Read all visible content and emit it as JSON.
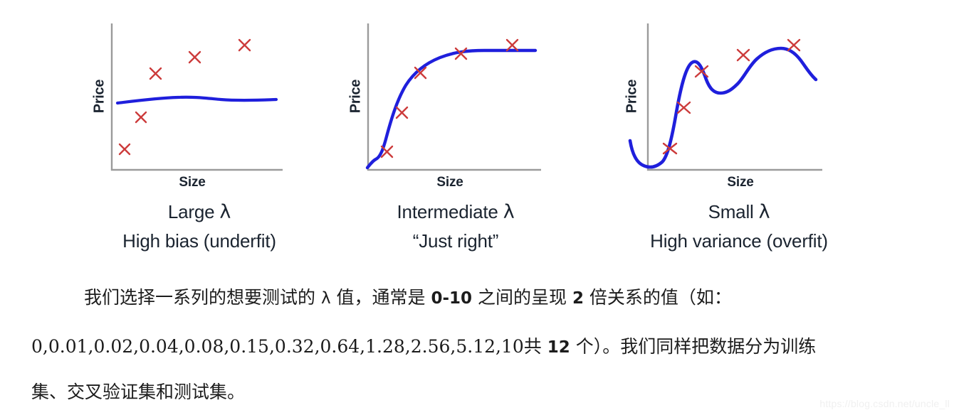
{
  "panels": [
    {
      "id": "large-lambda",
      "y_axis_label": "Price",
      "x_axis_label": "Size",
      "caption_main_prefix": "Large ",
      "caption_lambda": "λ",
      "caption_sub": "High bias (underfit)"
    },
    {
      "id": "intermediate-lambda",
      "y_axis_label": "Price",
      "x_axis_label": "Size",
      "caption_main_prefix": "Intermediate ",
      "caption_lambda": "λ",
      "caption_sub": "“Just right”"
    },
    {
      "id": "small-lambda",
      "y_axis_label": "Price",
      "x_axis_label": "Size",
      "caption_main_prefix": "Small ",
      "caption_lambda": "λ",
      "caption_sub": "High variance (overfit)"
    }
  ],
  "body_text": {
    "line1_a": "我们选择一系列的想要测试的 ",
    "line1_lambda": "λ",
    "line1_b": " 值，通常是 ",
    "line1_num1": "0-10",
    "line1_c": " 之间的呈现 ",
    "line1_num2": "2",
    "line1_d": " 倍关系的值（如：",
    "line2_nums": "0,0.01,0.02,0.04,0.08,0.15,0.32,0.64,1.28,2.56,5.12,10",
    "line2_a": "共 ",
    "line2_num": "12",
    "line2_b": " 个）。我们同样把数据分为训练",
    "line3": "集、交叉验证集和测试集。"
  },
  "watermark": "https://blog.csdn.net/uncle_ll",
  "colors": {
    "curve": "#1f1fdc",
    "marker": "#cc3b3b",
    "axis": "#9b9b9b",
    "text": "#1b2430",
    "body_text": "#1c1c1c",
    "watermark": "#f0f0f0",
    "background": "#ffffff"
  },
  "chart_data": [
    {
      "type": "scatter",
      "title": "Large λ — High bias (underfit)",
      "xlabel": "Size",
      "ylabel": "Price",
      "xlim": [
        0,
        100
      ],
      "ylim": [
        0,
        100
      ],
      "grid": false,
      "legend": null,
      "scatter_points": [
        {
          "x": 11,
          "y": 14
        },
        {
          "x": 20,
          "y": 35
        },
        {
          "x": 29,
          "y": 65
        },
        {
          "x": 50,
          "y": 76
        },
        {
          "x": 73,
          "y": 84
        }
      ],
      "curve": {
        "name": "fitted model",
        "points": [
          {
            "x": 5,
            "y": 50
          },
          {
            "x": 20,
            "y": 51
          },
          {
            "x": 35,
            "y": 52
          },
          {
            "x": 48,
            "y": 53
          },
          {
            "x": 60,
            "y": 52
          },
          {
            "x": 75,
            "y": 51
          },
          {
            "x": 92,
            "y": 51
          }
        ]
      }
    },
    {
      "type": "scatter",
      "title": "Intermediate λ — “Just right”",
      "xlabel": "Size",
      "ylabel": "Price",
      "xlim": [
        0,
        100
      ],
      "ylim": [
        0,
        100
      ],
      "grid": false,
      "legend": null,
      "scatter_points": [
        {
          "x": 13,
          "y": 12
        },
        {
          "x": 21,
          "y": 37
        },
        {
          "x": 37,
          "y": 63
        },
        {
          "x": 57,
          "y": 76
        },
        {
          "x": 84,
          "y": 82
        }
      ],
      "curve": {
        "name": "fitted model",
        "points": [
          {
            "x": 2,
            "y": 2
          },
          {
            "x": 8,
            "y": 6
          },
          {
            "x": 14,
            "y": 22
          },
          {
            "x": 22,
            "y": 44
          },
          {
            "x": 30,
            "y": 58
          },
          {
            "x": 42,
            "y": 68
          },
          {
            "x": 55,
            "y": 74
          },
          {
            "x": 66,
            "y": 76
          },
          {
            "x": 80,
            "y": 76
          },
          {
            "x": 96,
            "y": 76
          }
        ]
      }
    },
    {
      "type": "scatter",
      "title": "Small λ — High variance (overfit)",
      "xlabel": "Size",
      "ylabel": "Price",
      "xlim": [
        0,
        100
      ],
      "ylim": [
        0,
        100
      ],
      "grid": false,
      "legend": null,
      "scatter_points": [
        {
          "x": 12,
          "y": 10
        },
        {
          "x": 20,
          "y": 33
        },
        {
          "x": 35,
          "y": 58
        },
        {
          "x": 58,
          "y": 73
        },
        {
          "x": 82,
          "y": 80
        }
      ],
      "curve": {
        "name": "fitted model",
        "points": [
          {
            "x": -6,
            "y": 20
          },
          {
            "x": -1,
            "y": 6
          },
          {
            "x": 5,
            "y": 2
          },
          {
            "x": 12,
            "y": 5
          },
          {
            "x": 18,
            "y": 30
          },
          {
            "x": 24,
            "y": 58
          },
          {
            "x": 28,
            "y": 67
          },
          {
            "x": 33,
            "y": 62
          },
          {
            "x": 40,
            "y": 56
          },
          {
            "x": 48,
            "y": 57
          },
          {
            "x": 55,
            "y": 68
          },
          {
            "x": 63,
            "y": 80
          },
          {
            "x": 72,
            "y": 86
          },
          {
            "x": 82,
            "y": 83
          },
          {
            "x": 92,
            "y": 72
          }
        ]
      }
    }
  ]
}
